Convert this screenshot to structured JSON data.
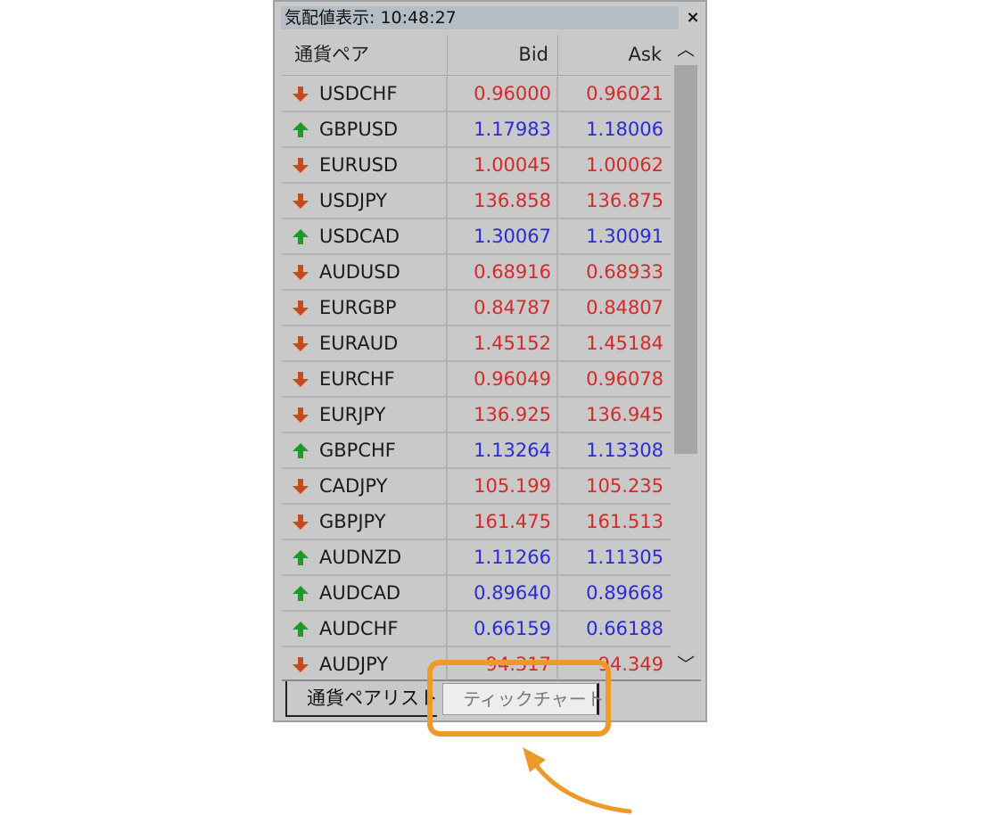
{
  "window": {
    "title": "気配値表示: 10:48:27",
    "close_label": "×"
  },
  "columns": {
    "symbol": "通貨ペア",
    "bid": "Bid",
    "ask": "Ask"
  },
  "colors": {
    "up": "#2b2bd6",
    "down": "#d42a2a",
    "up_arrow": "#1f9a2a",
    "down_arrow": "#c8491e",
    "highlight": "#ee9a2a"
  },
  "rows": [
    {
      "symbol": "USDCHF",
      "bid": "0.96000",
      "ask": "0.96021",
      "direction": "down"
    },
    {
      "symbol": "GBPUSD",
      "bid": "1.17983",
      "ask": "1.18006",
      "direction": "up"
    },
    {
      "symbol": "EURUSD",
      "bid": "1.00045",
      "ask": "1.00062",
      "direction": "down"
    },
    {
      "symbol": "USDJPY",
      "bid": "136.858",
      "ask": "136.875",
      "direction": "down"
    },
    {
      "symbol": "USDCAD",
      "bid": "1.30067",
      "ask": "1.30091",
      "direction": "up"
    },
    {
      "symbol": "AUDUSD",
      "bid": "0.68916",
      "ask": "0.68933",
      "direction": "down"
    },
    {
      "symbol": "EURGBP",
      "bid": "0.84787",
      "ask": "0.84807",
      "direction": "down"
    },
    {
      "symbol": "EURAUD",
      "bid": "1.45152",
      "ask": "1.45184",
      "direction": "down"
    },
    {
      "symbol": "EURCHF",
      "bid": "0.96049",
      "ask": "0.96078",
      "direction": "down"
    },
    {
      "symbol": "EURJPY",
      "bid": "136.925",
      "ask": "136.945",
      "direction": "down"
    },
    {
      "symbol": "GBPCHF",
      "bid": "1.13264",
      "ask": "1.13308",
      "direction": "up"
    },
    {
      "symbol": "CADJPY",
      "bid": "105.199",
      "ask": "105.235",
      "direction": "down"
    },
    {
      "symbol": "GBPJPY",
      "bid": "161.475",
      "ask": "161.513",
      "direction": "down"
    },
    {
      "symbol": "AUDNZD",
      "bid": "1.11266",
      "ask": "1.11305",
      "direction": "up"
    },
    {
      "symbol": "AUDCAD",
      "bid": "0.89640",
      "ask": "0.89668",
      "direction": "up"
    },
    {
      "symbol": "AUDCHF",
      "bid": "0.66159",
      "ask": "0.66188",
      "direction": "up"
    },
    {
      "symbol": "AUDJPY",
      "bid": "94.317",
      "ask": "94.349",
      "direction": "down"
    }
  ],
  "scrollbar": {
    "up_icon": "chevron-up-icon",
    "down_icon": "chevron-down-icon"
  },
  "tabs": [
    {
      "label": "通貨ペアリスト"
    },
    {
      "label": "ティックチャート"
    }
  ]
}
